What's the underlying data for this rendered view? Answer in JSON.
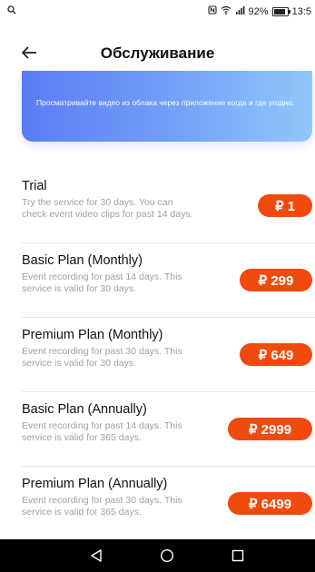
{
  "status_bar": {
    "left_icon": "search-icon",
    "battery_percent": "92%",
    "time": "13:5"
  },
  "header": {
    "title": "Обслуживание",
    "back_icon": "arrow-left-icon"
  },
  "banner": {
    "text": "Просматривайте видео из облака через приложение когда и где угодно."
  },
  "plans": [
    {
      "name": "Trial",
      "description": "Try the service for 30 days. You can check event video clips for past 14 days.",
      "price": "₽ 1"
    },
    {
      "name": "Basic Plan (Monthly)",
      "description": "Event recording for past 14 days. This service is valid for 30 days.",
      "price": "₽ 299"
    },
    {
      "name": "Premium Plan (Monthly)",
      "description": "Event recording for past 30 days. This service is valid for 30 days.",
      "price": "₽ 649"
    },
    {
      "name": "Basic Plan (Annually)",
      "description": "Event recording for past 14 days. This service is valid for 365 days.",
      "price": "₽ 2999"
    },
    {
      "name": "Premium Plan (Annually)",
      "description": "Event recording for past 30 days. This service is valid for 365 days.",
      "price": "₽ 6499"
    }
  ],
  "colors": {
    "accent": "#f04a0e",
    "banner_start": "#5b7cf5",
    "banner_end": "#8fc8fb",
    "muted_text": "#a0a0a0"
  },
  "nav_bar": {
    "icons": [
      "triangle-back-icon",
      "circle-home-icon",
      "square-recents-icon"
    ]
  }
}
